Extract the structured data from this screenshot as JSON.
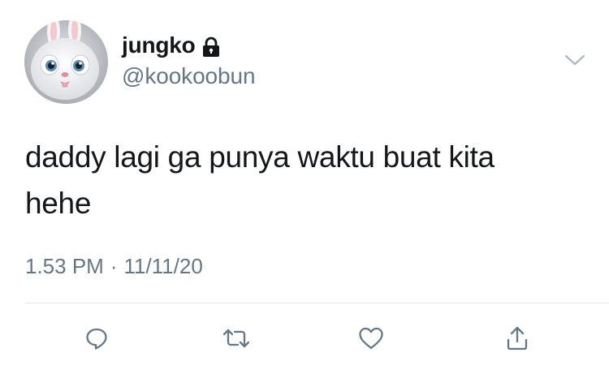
{
  "tweet": {
    "display_name": "jungko",
    "handle": "@kookoobun",
    "text": "daddy lagi ga punya waktu buat kita\nhehe",
    "time": "1.53 PM",
    "separator": "·",
    "date": "11/11/20"
  },
  "icons": {
    "lock": "lock-icon",
    "caret": "chevron-down-icon",
    "reply": "reply-icon",
    "retweet": "retweet-icon",
    "like": "heart-icon",
    "share": "share-icon"
  },
  "colors": {
    "primary_text": "#14171a",
    "secondary_text": "#657786",
    "divider": "#e1e8ed",
    "icon": "#657786"
  }
}
